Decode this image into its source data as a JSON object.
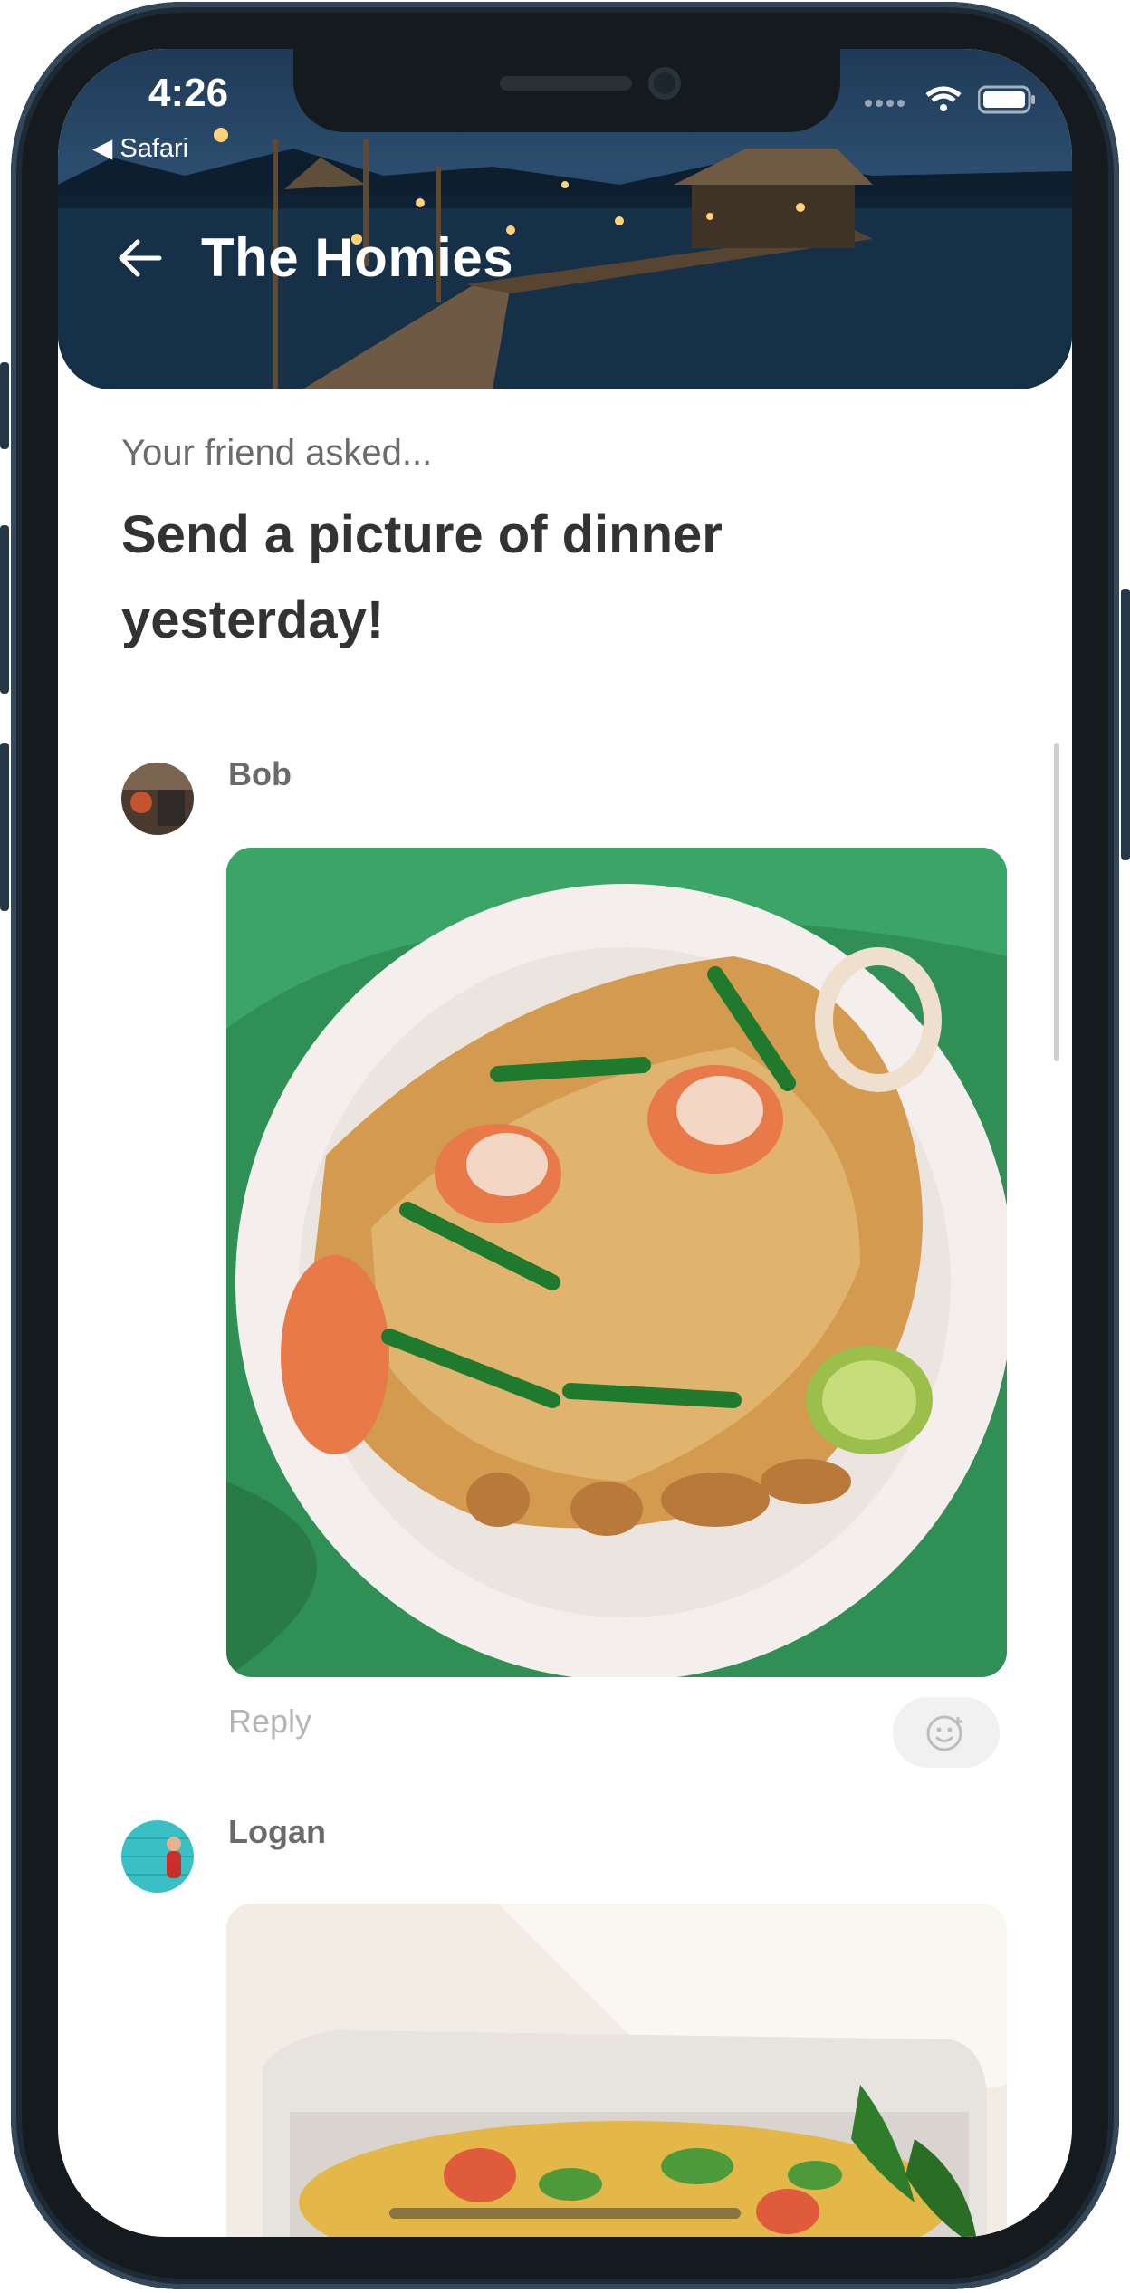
{
  "status_bar": {
    "time": "4:26",
    "back_app": "◀ Safari",
    "icons": [
      "signal-icon",
      "wifi-icon",
      "battery-icon"
    ]
  },
  "header": {
    "title": "The Homies",
    "back_icon": "arrow-left-icon"
  },
  "prompt": {
    "label": "Your friend asked...",
    "text": "Send a picture of dinner yesterday!"
  },
  "posts": [
    {
      "author": "Bob",
      "reply_label": "Reply",
      "react_icon": "emoji-add-icon",
      "image_alt": "pad thai with shrimp on a plate"
    },
    {
      "author": "Logan",
      "image_alt": "salad bowl"
    }
  ],
  "colors": {
    "header_bg": "#1f3a58",
    "title_text": "#333333",
    "muted_text": "#6b6b6b",
    "reply_text": "#b5b5b5",
    "plate_green": "#2f8f55"
  }
}
